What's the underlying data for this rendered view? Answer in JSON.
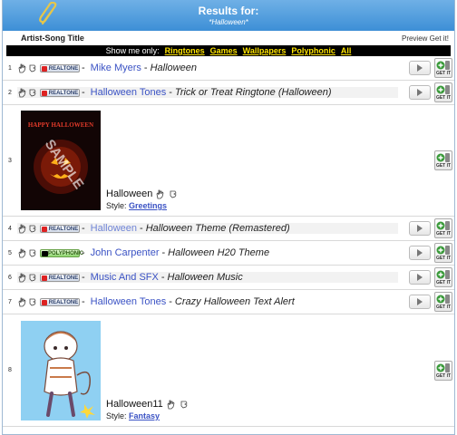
{
  "header": {
    "title": "Results for:",
    "subtitle": "*Halloween*"
  },
  "columns": {
    "title": "Artist-Song Title",
    "preview": "Preview Get it!"
  },
  "filter": {
    "label": "Show me only:",
    "options": [
      "Ringtones",
      "Games",
      "Wallpapers",
      "Polyphonic",
      "All"
    ]
  },
  "badges": {
    "realtone": "REALTONE",
    "polyphonic": "POLYPHONIC"
  },
  "get_it_label": "GET IT",
  "rows": [
    {
      "num": "1",
      "artist": "Mike Myers",
      "song": "Halloween",
      "badge": "realtone"
    },
    {
      "num": "2",
      "artist": "Halloween Tones",
      "song": "Trick or Treat Ringtone (Halloween)",
      "badge": "realtone"
    },
    {
      "num": "3",
      "name": "Halloween",
      "style_label": "Style:",
      "style": "Greetings"
    },
    {
      "num": "4",
      "artist": "Halloween",
      "song": "Halloween Theme (Remastered)",
      "badge": "realtone"
    },
    {
      "num": "5",
      "artist": "John Carpenter",
      "song": "Halloween H20 Theme",
      "badge": "polyphonic"
    },
    {
      "num": "6",
      "artist": "Music And SFX",
      "song": "Halloween Music",
      "badge": "realtone"
    },
    {
      "num": "7",
      "artist": "Halloween Tones",
      "song": "Crazy Halloween Text Alert",
      "badge": "realtone"
    },
    {
      "num": "8",
      "name": "Halloween11",
      "style_label": "Style:",
      "style": "Fantasy"
    }
  ],
  "wallpaper_1_text": "HAPPY HALLOWEEN",
  "watermark": "SAMPLE"
}
